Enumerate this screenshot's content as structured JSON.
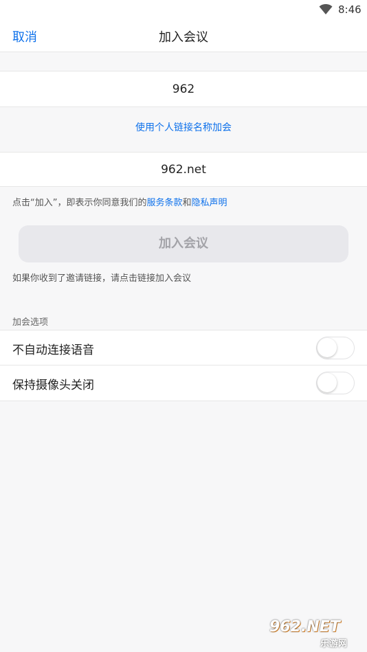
{
  "status_bar": {
    "time": "8:46",
    "wifi_icon": "wifi-icon"
  },
  "nav": {
    "cancel": "取消",
    "title": "加入会议"
  },
  "meeting_id_field": {
    "value": "962"
  },
  "personal_link": "使用个人链接名称加会",
  "name_field": {
    "value": "962.net"
  },
  "terms": {
    "prefix": "点击“加入”，即表示你同意我们的",
    "service": "服务条款",
    "and": "和",
    "privacy": "隐私声明"
  },
  "join_button": {
    "label": "加入会议"
  },
  "invite_hint": "如果你收到了邀请链接，请点击链接加入会议",
  "options": {
    "header": "加会选项",
    "items": [
      {
        "label": "不自动连接语音",
        "enabled": false
      },
      {
        "label": "保持摄像头关闭",
        "enabled": false
      }
    ]
  },
  "watermark": {
    "logo": "962.NET",
    "sub": "乐游网"
  },
  "colors": {
    "accent": "#0e71eb",
    "background": "#f7f7f8",
    "disabled_button": "#e8e8ec"
  }
}
